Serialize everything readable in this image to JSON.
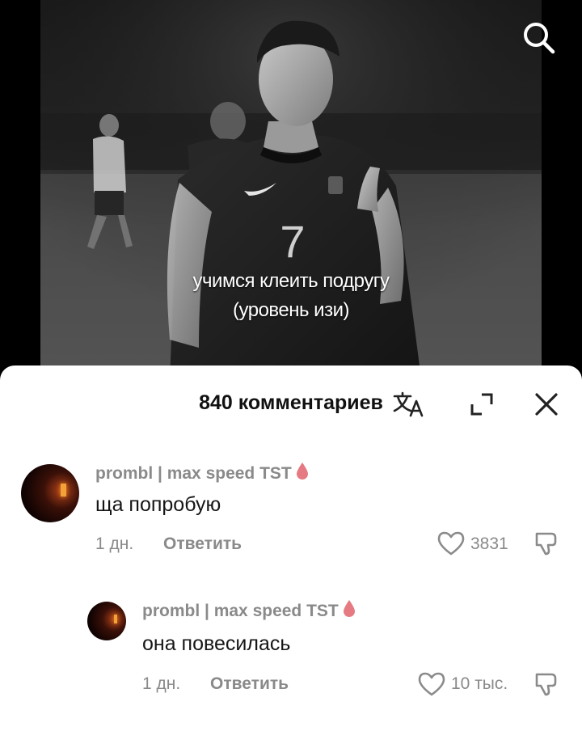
{
  "video": {
    "caption_line1": "учимся клеить подругу",
    "caption_line2": "(уровень изи)",
    "jersey_number": "7",
    "search_icon": "search-icon"
  },
  "comments_sheet": {
    "title": "840 комментариев",
    "icons": [
      "translate-icon",
      "expand-icon",
      "close-icon"
    ]
  },
  "comments": [
    {
      "username": "prombl | max speed TST",
      "badge_icon": "blood-drop-icon",
      "text": "ща попробую",
      "time": "1 дн.",
      "reply_label": "Ответить",
      "likes": "3831"
    },
    {
      "username": "prombl | max speed TST",
      "badge_icon": "blood-drop-icon",
      "text": "она повесилась",
      "time": "1 дн.",
      "reply_label": "Ответить",
      "likes": "10 тыс."
    }
  ],
  "colors": {
    "sheet_bg": "#ffffff",
    "muted_text": "#8a8a8a",
    "primary_text": "#161616",
    "badge": "#e57a82"
  }
}
